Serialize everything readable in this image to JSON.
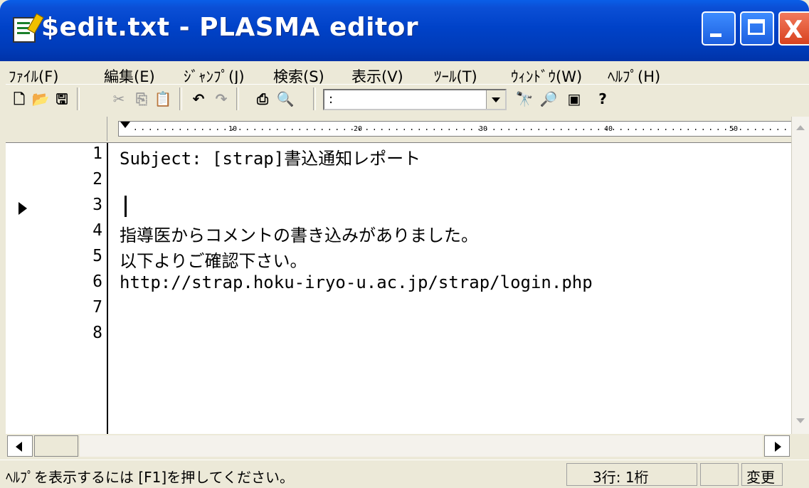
{
  "window": {
    "title": "$edit.txt - PLASMA editor",
    "close_glyph": "X"
  },
  "menu": [
    "ﾌｧｲﾙ(F)",
    "編集(E)",
    "ｼﾞｬﾝﾌﾟ(J)",
    "検索(S)",
    "表示(V)",
    "ﾂｰﾙ(T)",
    "ｳｨﾝﾄﾞｳ(W)",
    "ﾍﾙﾌﾟ(H)"
  ],
  "toolbar": {
    "combo_value": ":",
    "icons": [
      "new-file-icon",
      "open-folder-icon",
      "save-icon",
      "cut-icon",
      "copy-icon",
      "paste-icon",
      "undo-icon",
      "redo-icon",
      "print-icon",
      "print-preview-icon",
      "find-icon",
      "find-next-icon",
      "window-icon",
      "help-icon"
    ]
  },
  "ruler": {
    "ticks": [
      "10",
      "20",
      "30",
      "40",
      "50"
    ]
  },
  "editor": {
    "current_line": 3,
    "lines": [
      {
        "num": "1",
        "text": "Subject: [strap]書込通知レポート"
      },
      {
        "num": "2",
        "text": ""
      },
      {
        "num": "3",
        "text": ""
      },
      {
        "num": "4",
        "text": "指導医からコメントの書き込みがありました。"
      },
      {
        "num": "5",
        "text": "以下よりご確認下さい。"
      },
      {
        "num": "6",
        "text": "http://strap.hoku-iryo-u.ac.jp/strap/login.php"
      },
      {
        "num": "7",
        "text": ""
      },
      {
        "num": "8",
        "text": ""
      }
    ]
  },
  "status": {
    "help_text": "ﾍﾙﾌﾟを表示するには [F1]を押してください。",
    "position": "3行:  1桁",
    "modified": "変更"
  }
}
